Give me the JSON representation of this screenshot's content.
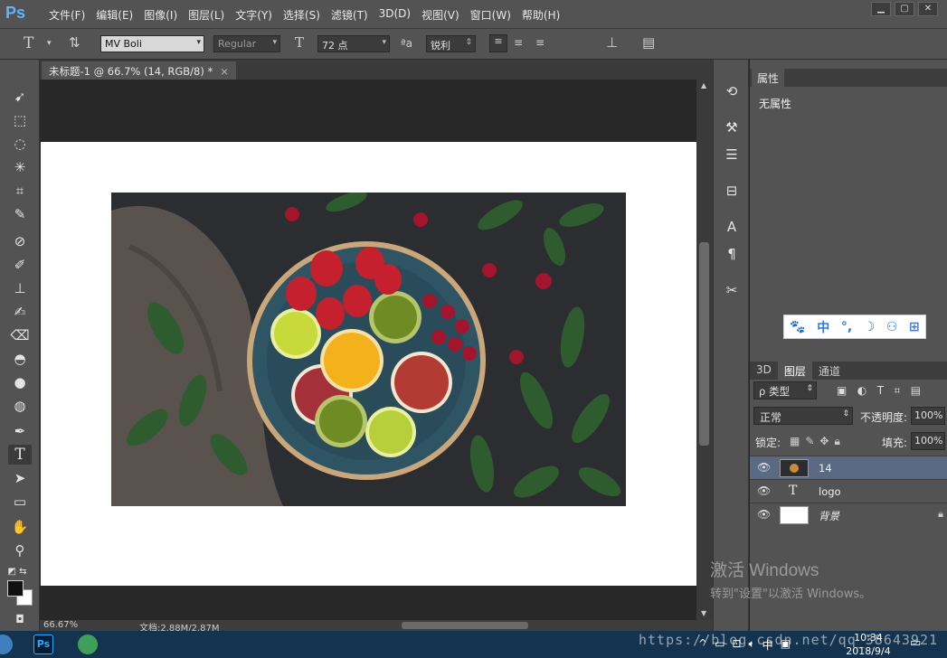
{
  "app": {
    "logo": "Ps"
  },
  "menu": [
    "文件(F)",
    "编辑(E)",
    "图像(I)",
    "图层(L)",
    "文字(Y)",
    "选择(S)",
    "滤镜(T)",
    "3D(D)",
    "视图(V)",
    "窗口(W)",
    "帮助(H)"
  ],
  "options": {
    "font_family": "MV Boli",
    "font_style": "Regular",
    "font_size": "72 点",
    "aa_label": "ªa",
    "antialias": "锐利",
    "text_color": "#111111"
  },
  "document": {
    "tab_title": "未标题-1 @ 66.7% (14, RGB/8) *",
    "close": "×",
    "zoom": "66.67%",
    "doc_size": "文档:2.88M/2.87M"
  },
  "properties": {
    "tab": "属性",
    "content": "无属性"
  },
  "ime": {
    "items": [
      "🐾",
      "中",
      "°,",
      "☽",
      "⚇",
      "⊞"
    ]
  },
  "layers": {
    "tabs": [
      "3D",
      "图层",
      "通道"
    ],
    "active_tab": "图层",
    "filter_label": "ρ 类型",
    "blend_mode": "正常",
    "opacity_label": "不透明度:",
    "opacity": "100%",
    "lock_label": "锁定:",
    "fill_label": "填充:",
    "fill": "100%",
    "items": [
      {
        "name": "14",
        "type": "image",
        "selected": true
      },
      {
        "name": "logo",
        "type": "text",
        "icon": "T",
        "selected": false
      },
      {
        "name": "背景",
        "type": "background",
        "selected": false
      }
    ]
  },
  "watermark": {
    "line1": "激活 Windows",
    "line2": "转到\"设置\"以激活 Windows。"
  },
  "taskbar": {
    "time": "10:34",
    "date": "2018/9/4",
    "ime": "中",
    "url": "https://blog.csdn.net/qq_38643921"
  }
}
